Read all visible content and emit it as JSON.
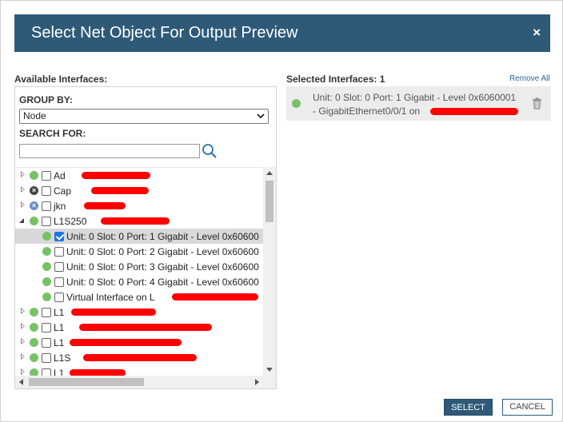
{
  "dialog": {
    "title": "Select Net Object For Output Preview",
    "close_glyph": "×"
  },
  "available": {
    "heading": "Available Interfaces:",
    "group_by_label": "GROUP BY:",
    "group_by_value": "Node",
    "search_label": "SEARCH FOR:",
    "search_value": ""
  },
  "tree": {
    "rows": [
      {
        "text": "Ad",
        "status": "green",
        "expander": "collapsed",
        "checked": false,
        "indent": 0
      },
      {
        "text": "Cap",
        "status": "black",
        "expander": "collapsed",
        "checked": false,
        "indent": 0
      },
      {
        "text": "jkn",
        "status": "blue",
        "expander": "collapsed",
        "checked": false,
        "indent": 0
      },
      {
        "text": "L1S250",
        "status": "green",
        "expander": "expanded",
        "checked": false,
        "indent": 0
      },
      {
        "text": "Unit: 0 Slot: 0 Port: 1 Gigabit - Level 0x60600",
        "status": "green",
        "expander": "none",
        "checked": true,
        "indent": 1,
        "selected": true
      },
      {
        "text": "Unit: 0 Slot: 0 Port: 2 Gigabit - Level 0x60600",
        "status": "green",
        "expander": "none",
        "checked": false,
        "indent": 1
      },
      {
        "text": "Unit: 0 Slot: 0 Port: 3 Gigabit - Level 0x60600",
        "status": "green",
        "expander": "none",
        "checked": false,
        "indent": 1
      },
      {
        "text": "Unit: 0 Slot: 0 Port: 4 Gigabit - Level 0x60600",
        "status": "green",
        "expander": "none",
        "checked": false,
        "indent": 1
      },
      {
        "text": "Virtual Interface on L",
        "status": "green",
        "expander": "none",
        "checked": false,
        "indent": 1
      },
      {
        "text": "L1",
        "status": "green",
        "expander": "collapsed",
        "checked": false,
        "indent": 0
      },
      {
        "text": "L1",
        "status": "green",
        "expander": "collapsed",
        "checked": false,
        "indent": 0
      },
      {
        "text": "L1",
        "status": "green",
        "expander": "collapsed",
        "checked": false,
        "indent": 0
      },
      {
        "text": "L1S",
        "status": "green",
        "expander": "collapsed",
        "checked": false,
        "indent": 0
      },
      {
        "text": "L1",
        "status": "green",
        "expander": "collapsed",
        "checked": false,
        "indent": 0
      }
    ]
  },
  "selected": {
    "heading": "Selected Interfaces: 1",
    "remove_all": "Remove All",
    "item_line1": "Unit: 0 Slot: 0 Port: 1 Gigabit - Level 0x6060001",
    "item_line2": "- GigabitEthernet0/0/1 on"
  },
  "buttons": {
    "select": "SELECT",
    "cancel": "CANCEL"
  },
  "colors": {
    "titlebar": "#2e5a78",
    "status_green": "#77c267",
    "redaction": "#ff0000"
  },
  "icons": [
    "close-icon",
    "search-icon",
    "trash-icon",
    "chevron-down-icon",
    "expander-icon",
    "status-icon",
    "checkbox-icon"
  ]
}
